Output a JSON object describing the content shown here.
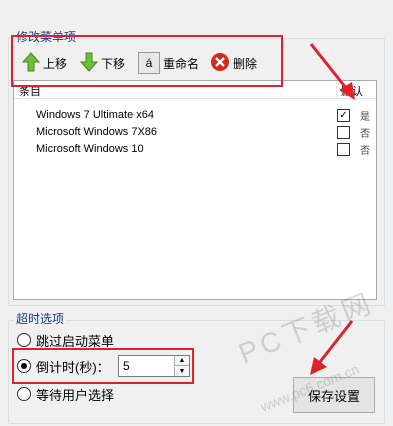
{
  "edit_menu": {
    "legend": "修改菜单项",
    "toolbar": {
      "up_label": "上移",
      "down_label": "下移",
      "rename_icon_text": "á",
      "rename_label": "重命名",
      "delete_label": "删除"
    },
    "list": {
      "col_entry": "条目",
      "col_default": "默认",
      "rows": [
        {
          "name": "Windows 7 Ultimate x64",
          "checked": true,
          "flag": "是"
        },
        {
          "name": "Microsoft Windows 7X86",
          "checked": false,
          "flag": "否"
        },
        {
          "name": "Microsoft Windows 10",
          "checked": false,
          "flag": "否"
        }
      ]
    }
  },
  "timeout": {
    "legend": "超时选项",
    "options": [
      "跳过启动菜单",
      "倒计时(秒)：",
      "等待用户选择"
    ],
    "selected_index": 1,
    "countdown_value": "5"
  },
  "save_button_label": "保存设置",
  "watermark": {
    "text": "PC下载网",
    "url": "www.pc6.com.cn"
  },
  "colors": {
    "annotation": "#e0202a",
    "legend": "#1a3c8a"
  }
}
